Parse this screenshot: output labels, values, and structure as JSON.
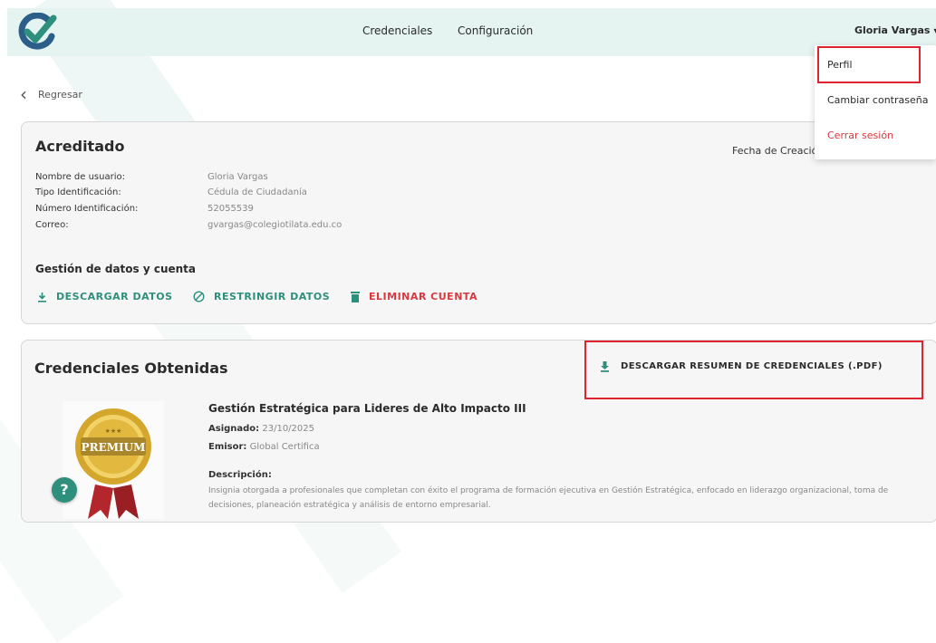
{
  "header": {
    "nav": [
      "Credenciales",
      "Configuración"
    ],
    "user_name": "Gloria Vargas",
    "brand_color": "#2e8f7d",
    "logo_icon": "checkmark-logo-icon"
  },
  "user_dropdown": {
    "items": [
      "Perfil",
      "Cambiar contraseña",
      "Cerrar sesión"
    ],
    "highlighted": "Perfil"
  },
  "back": {
    "label": "Regresar",
    "icon": "chevron-left-icon"
  },
  "accredited": {
    "title": "Acreditado",
    "date_label": "Fecha de Creació",
    "fields": [
      {
        "label": "Nombre de usuario:",
        "value": "Gloria Vargas"
      },
      {
        "label": "Tipo Identificación:",
        "value": "Cédula de Ciudadanía"
      },
      {
        "label": "Número Identificación:",
        "value": "52055539"
      },
      {
        "label": "Correo:",
        "value": "gvargas@colegiotilata.edu.co"
      }
    ],
    "account_section_title": "Gestión de datos y cuenta",
    "actions": [
      {
        "label": "DESCARGAR DATOS",
        "icon": "download-icon"
      },
      {
        "label": "RESTRINGIR DATOS",
        "icon": "block-icon"
      },
      {
        "label": "ELIMINAR CUENTA",
        "icon": "trash-icon"
      }
    ]
  },
  "credentials": {
    "title": "Credenciales Obtenidas",
    "download_summary": "DESCARGAR RESUMEN DE CREDENCIALES (.PDF)",
    "item": {
      "badge_text": "PREMIUM",
      "name": "Gestión Estratégica para Lideres de Alto Impacto III",
      "assigned_label": "Asignado:",
      "assigned_value": "23/10/2025",
      "issuer_label": "Emisor:",
      "issuer_value": "Global Certifica",
      "description_label": "Descripción:",
      "description": "Insignia otorgada a profesionales que completan con éxito el programa de formación ejecutiva en Gestión Estratégica, enfocado en liderazgo organizacional, toma de decisiones, planeación estratégica y análisis de entorno empresarial."
    }
  },
  "help_button": "?",
  "colors": {
    "accent": "#2e8f7d",
    "danger": "#d9383e",
    "highlight": "#e0242f",
    "header_bg": "#e5f4f1"
  }
}
